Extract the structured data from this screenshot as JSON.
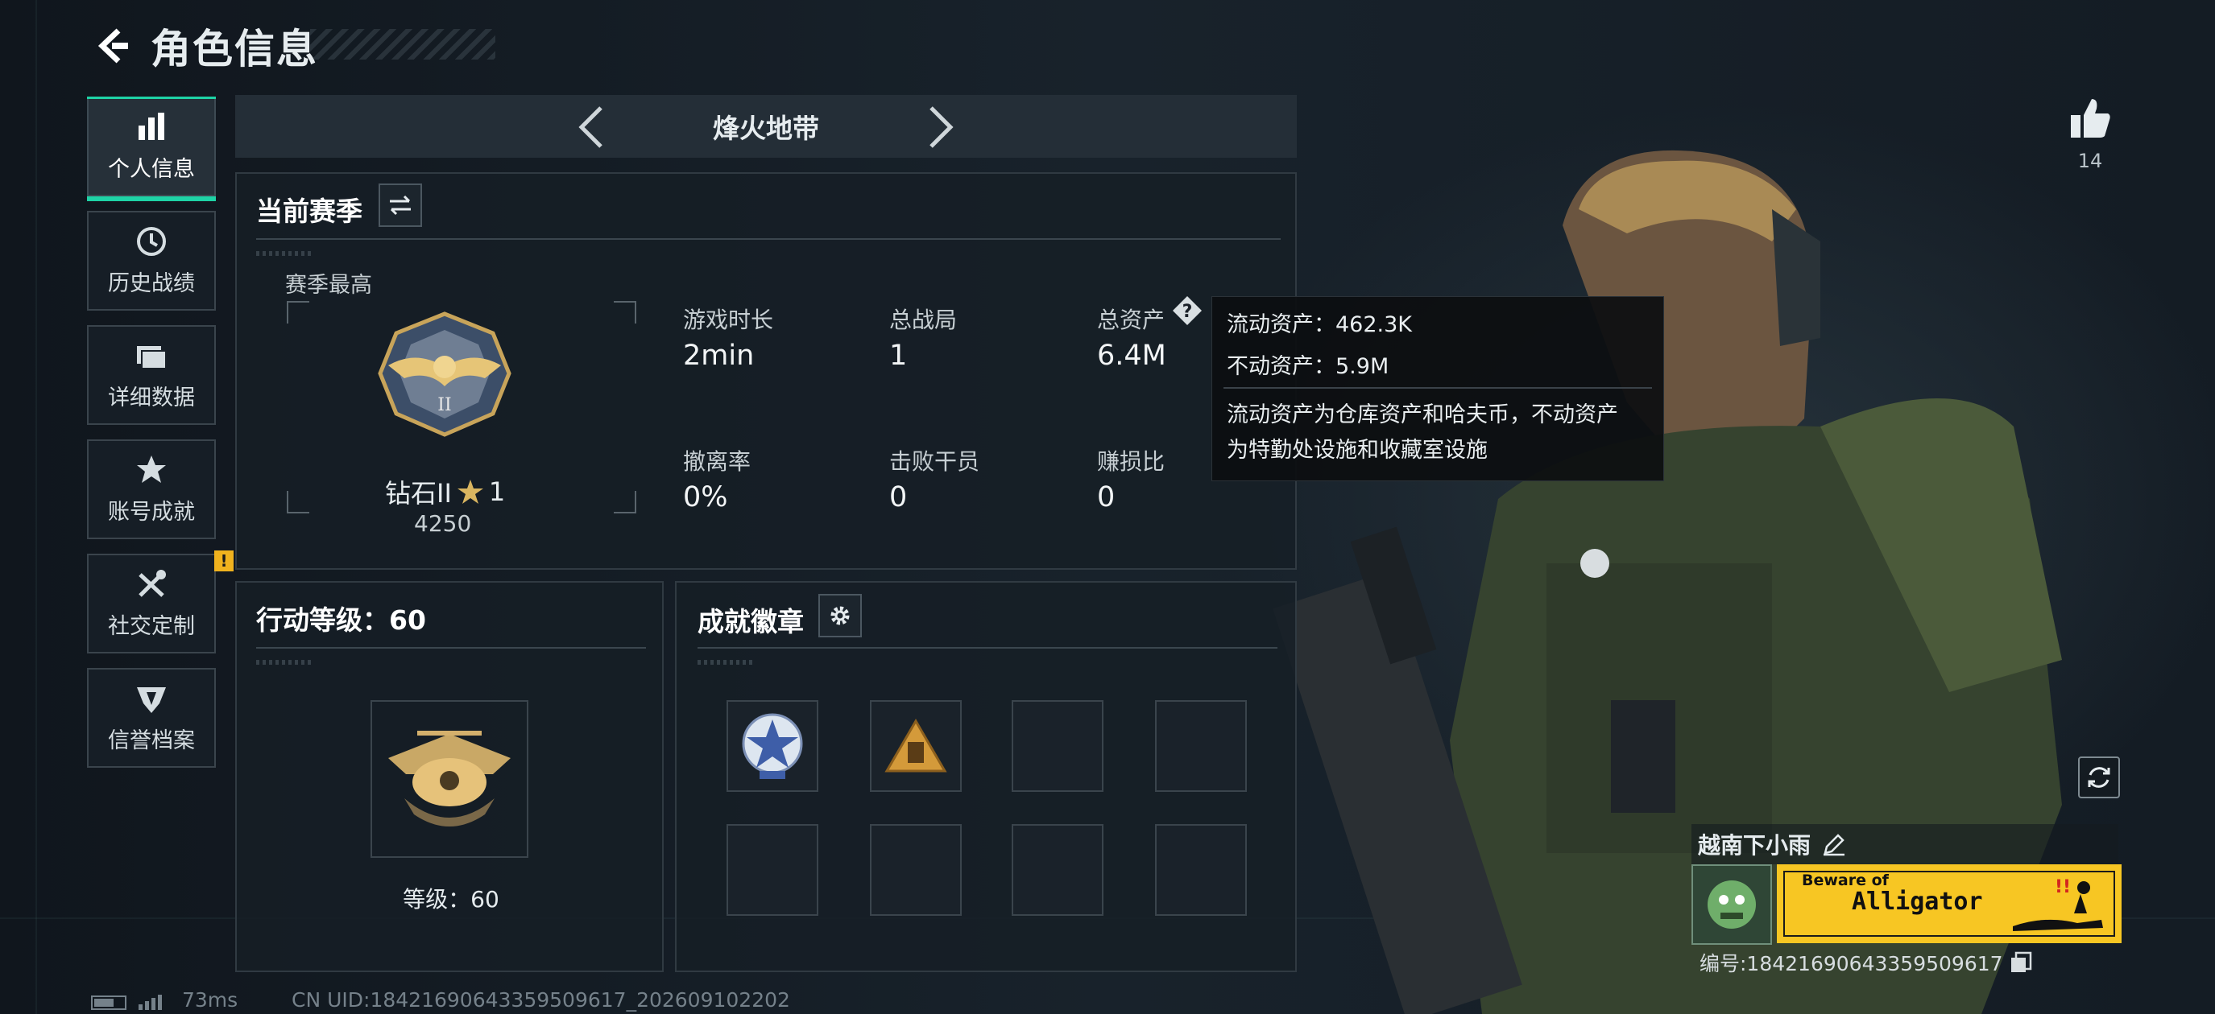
{
  "header": {
    "title": "角色信息"
  },
  "sidebar": {
    "items": [
      {
        "label": "个人信息",
        "active": true,
        "icon": "bar-chart-icon"
      },
      {
        "label": "历史战绩",
        "icon": "clock-icon"
      },
      {
        "label": "详细数据",
        "icon": "folders-icon"
      },
      {
        "label": "账号成就",
        "icon": "achievement-star-icon"
      },
      {
        "label": "社交定制",
        "icon": "tools-icon",
        "badge": "!"
      },
      {
        "label": "信誉档案",
        "icon": "emblem-icon"
      }
    ]
  },
  "mode": {
    "name": "烽火地带"
  },
  "season": {
    "title": "当前赛季",
    "peak_label": "赛季最高",
    "rank_name": "钻石II",
    "rank_stars": "1",
    "rank_score": "4250",
    "stats": [
      {
        "label": "游戏时长",
        "value": "2min"
      },
      {
        "label": "总战局",
        "value": "1"
      },
      {
        "label": "总资产",
        "value": "6.4M"
      },
      {
        "label": "撤离率",
        "value": "0%"
      },
      {
        "label": "击败干员",
        "value": "0"
      },
      {
        "label": "赚损比",
        "value": "0"
      }
    ]
  },
  "tooltip": {
    "liquid": "流动资产：462.3K",
    "fixed": "不动资产：5.9M",
    "desc_line1": "流动资产为仓库资产和哈夫币，不动资产",
    "desc_line2": "为特勤处设施和收藏室设施"
  },
  "level": {
    "title": "行动等级：60",
    "label": "等级：60"
  },
  "badges": {
    "title": "成就徽章"
  },
  "profile": {
    "likes": "14",
    "player_name": "越南下小雨",
    "banner_line1": "Beware of",
    "banner_line2": "Alligator",
    "uid_label": "编号:18421690643359509617"
  },
  "footer": {
    "ping": "73ms",
    "uid": "CN UID:18421690643359509617_202609102202"
  },
  "colors": {
    "accent": "#1ed3a6",
    "warning": "#f0b21e",
    "banner": "#f7c623"
  }
}
